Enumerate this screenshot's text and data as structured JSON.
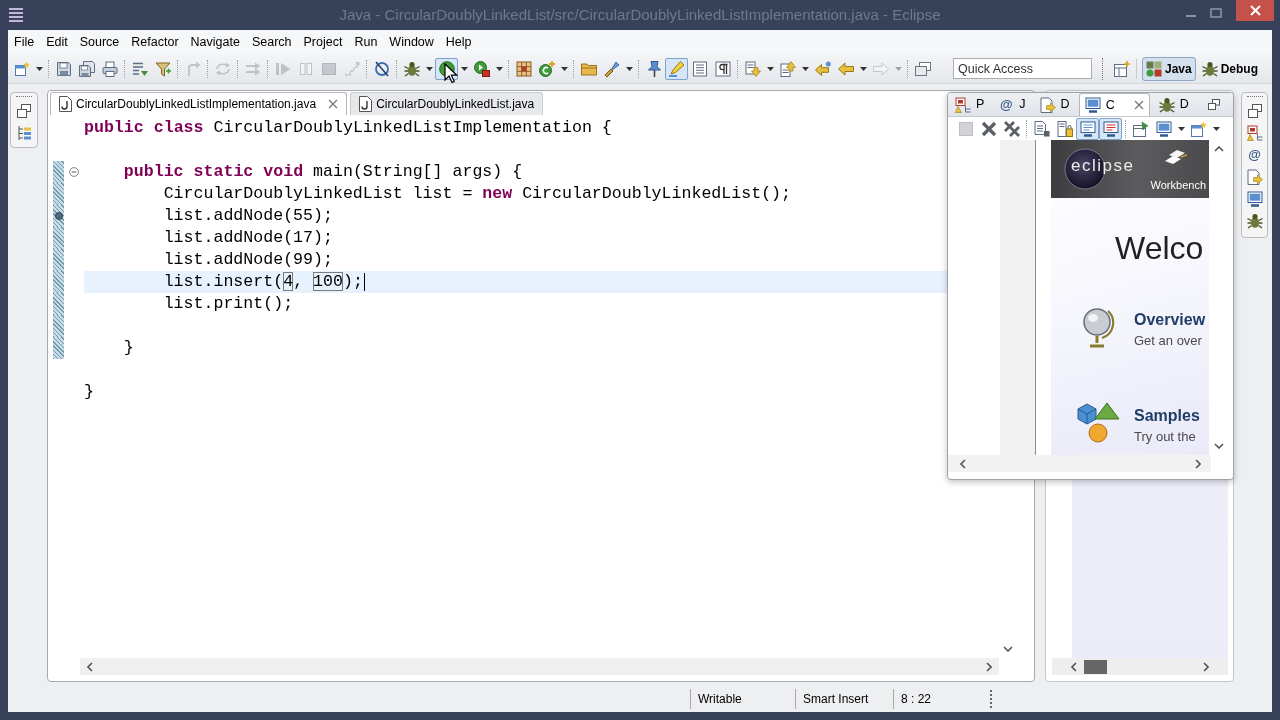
{
  "window": {
    "title": "Java - CircularDoublyLinkedList/src/CircularDoublyLinkedListImplementation.java - Eclipse"
  },
  "menu": [
    "File",
    "Edit",
    "Source",
    "Refactor",
    "Navigate",
    "Search",
    "Project",
    "Run",
    "Window",
    "Help"
  ],
  "toolbar": {
    "groups": [
      [
        {
          "kind": "new",
          "on": false,
          "disabled": false
        },
        {
          "kind": "dropdown",
          "on": false,
          "disabled": false
        }
      ],
      [
        {
          "kind": "save",
          "on": false,
          "disabled": false
        },
        {
          "kind": "save_all",
          "on": false,
          "disabled": false
        },
        {
          "kind": "print",
          "on": false,
          "disabled": false
        }
      ],
      [
        {
          "kind": "breadcrumb",
          "on": false,
          "disabled": false
        },
        {
          "kind": "filter",
          "on": false,
          "disabled": false
        }
      ],
      [
        {
          "kind": "curved_arrow",
          "on": false,
          "disabled": true
        }
      ],
      [
        {
          "kind": "cycle",
          "on": false,
          "disabled": true
        }
      ],
      [
        {
          "kind": "double_arrow",
          "on": false,
          "disabled": true
        }
      ],
      [
        {
          "kind": "resume",
          "on": false,
          "disabled": true
        },
        {
          "kind": "suspend",
          "on": false,
          "disabled": true
        },
        {
          "kind": "terminate",
          "on": false,
          "disabled": true
        },
        {
          "kind": "disconnect",
          "on": false,
          "disabled": true
        }
      ],
      [
        {
          "kind": "skip_breakpoints",
          "on": false,
          "disabled": false
        }
      ],
      [
        {
          "kind": "debug",
          "on": false,
          "disabled": false
        },
        {
          "kind": "dropdown",
          "on": false,
          "disabled": false
        },
        {
          "kind": "run",
          "on": true,
          "disabled": false
        },
        {
          "kind": "dropdown",
          "on": false,
          "disabled": false
        },
        {
          "kind": "external_tools",
          "on": false,
          "disabled": false
        },
        {
          "kind": "dropdown",
          "on": false,
          "disabled": false
        }
      ],
      [
        {
          "kind": "new_package",
          "on": false,
          "disabled": false
        },
        {
          "kind": "new_class",
          "on": false,
          "disabled": false
        },
        {
          "kind": "dropdown",
          "on": false,
          "disabled": false
        }
      ],
      [
        {
          "kind": "open_type",
          "on": false,
          "disabled": false
        },
        {
          "kind": "search",
          "on": false,
          "disabled": false
        },
        {
          "kind": "dropdown",
          "on": false,
          "disabled": false
        }
      ],
      [
        {
          "kind": "task",
          "on": false,
          "disabled": false
        },
        {
          "kind": "mark_occurrences",
          "on": true,
          "disabled": false
        },
        {
          "kind": "block_selection",
          "on": false,
          "disabled": false
        },
        {
          "kind": "show_whitespace",
          "on": false,
          "disabled": false
        }
      ],
      [
        {
          "kind": "next_annotation",
          "on": false,
          "disabled": false
        },
        {
          "kind": "dropdown",
          "on": false,
          "disabled": false
        },
        {
          "kind": "previous_annotation",
          "on": false,
          "disabled": false
        },
        {
          "kind": "dropdown",
          "on": false,
          "disabled": false
        },
        {
          "kind": "last_edit",
          "on": false,
          "disabled": false
        },
        {
          "kind": "back",
          "on": false,
          "disabled": false
        },
        {
          "kind": "dropdown",
          "on": false,
          "disabled": false
        },
        {
          "kind": "forward",
          "on": false,
          "disabled": true
        },
        {
          "kind": "dropdown",
          "on": false,
          "disabled": true
        }
      ],
      [
        {
          "kind": "pin_editor",
          "on": false,
          "disabled": false
        }
      ]
    ],
    "quick_access": {
      "placeholder": "Quick Access"
    },
    "perspectives": [
      {
        "kind": "java",
        "label": "Java",
        "selected": true
      },
      {
        "kind": "debug",
        "label": "Debug",
        "selected": false
      }
    ]
  },
  "left_trim": {
    "items": [
      {
        "kind": "restore"
      },
      {
        "kind": "outline"
      }
    ]
  },
  "editor": {
    "tabs": [
      {
        "label": "CircularDoublyLinkedListImplementation.java",
        "selected": true
      },
      {
        "label": "CircularDoublyLinkedList.java",
        "selected": false
      }
    ],
    "lines": [
      {
        "kind": "code",
        "current": false,
        "changed": false,
        "fold": false,
        "marker": false,
        "segments": [
          {
            "kind": "keyword",
            "text": "public "
          },
          {
            "kind": "keyword",
            "text": "class "
          },
          {
            "kind": "text",
            "text": "CircularDoublyLinkedListImplementation {"
          }
        ],
        "children": [
          {
            "kind": "blank",
            "current": false,
            "changed": false
          },
          {
            "kind": "code",
            "current": false,
            "changed": true,
            "fold": true,
            "marker": false,
            "segments": [
              {
                "kind": "keyword",
                "text": "public "
              },
              {
                "kind": "keyword",
                "text": "static "
              },
              {
                "kind": "keyword",
                "text": "void "
              },
              {
                "kind": "text",
                "text": "main(String[] args) {"
              }
            ],
            "children": [
              {
                "kind": "code",
                "current": false,
                "changed": true,
                "fold": false,
                "marker": false,
                "segments": [
                  {
                    "kind": "text",
                    "text": "CircularDoublyLinkedList list = "
                  },
                  {
                    "kind": "keyword",
                    "text": "new"
                  },
                  {
                    "kind": "text",
                    "text": " CircularDoublyLinkedList();"
                  }
                ]
              },
              {
                "kind": "code",
                "current": false,
                "changed": true,
                "fold": false,
                "marker": true,
                "segments": [
                  {
                    "kind": "text",
                    "text": "list.addNode(55);"
                  }
                ]
              },
              {
                "kind": "code",
                "current": false,
                "changed": true,
                "fold": false,
                "marker": false,
                "segments": [
                  {
                    "kind": "text",
                    "text": "list.addNode(17);"
                  }
                ]
              },
              {
                "kind": "code",
                "current": false,
                "changed": true,
                "fold": false,
                "marker": false,
                "segments": [
                  {
                    "kind": "text",
                    "text": "list.addNode(99);"
                  }
                ]
              },
              {
                "kind": "code",
                "current": true,
                "changed": true,
                "fold": false,
                "marker": false,
                "segments": [
                  {
                    "kind": "text",
                    "text": "list.insert("
                  },
                  {
                    "kind": "linked",
                    "text": "4"
                  },
                  {
                    "kind": "text",
                    "text": ", "
                  },
                  {
                    "kind": "linked",
                    "text": "100"
                  },
                  {
                    "kind": "text",
                    "text": ");"
                  }
                ]
              },
              {
                "kind": "code",
                "current": false,
                "changed": true,
                "fold": false,
                "marker": false,
                "segments": [
                  {
                    "kind": "text",
                    "text": "list.print();"
                  }
                ]
              },
              {
                "kind": "blank",
                "current": false,
                "changed": true
              }
            ]
          },
          {
            "kind": "code",
            "current": false,
            "changed": true,
            "fold": false,
            "marker": false,
            "segments": [
              {
                "kind": "text",
                "text": "}"
              }
            ]
          },
          {
            "kind": "blank",
            "current": false,
            "changed": false
          }
        ]
      },
      {
        "kind": "code",
        "current": false,
        "changed": false,
        "fold": false,
        "marker": false,
        "segments": [
          {
            "kind": "text",
            "text": "}"
          }
        ]
      }
    ]
  },
  "panel": {
    "tabs": [
      {
        "kind": "package",
        "label": "P",
        "selected": false
      },
      {
        "kind": "javadoc",
        "glyph": "@",
        "label": "J",
        "selected": false
      },
      {
        "kind": "declaration",
        "label": "D",
        "selected": false
      },
      {
        "kind": "console",
        "label": "C",
        "selected": true
      },
      {
        "kind": "debug",
        "label": "D",
        "selected": false
      }
    ],
    "toolbar": [
      [
        {
          "kind": "stop",
          "on": false,
          "disabled": true
        },
        {
          "kind": "remove",
          "on": false,
          "disabled": false
        },
        {
          "kind": "remove_all",
          "on": false,
          "disabled": false
        }
      ],
      [
        {
          "kind": "clear",
          "on": false,
          "disabled": false
        },
        {
          "kind": "scroll_lock",
          "on": false,
          "disabled": false
        },
        {
          "kind": "show_stdout",
          "on": true,
          "disabled": false
        },
        {
          "kind": "show_stderr",
          "on": true,
          "disabled": false
        }
      ],
      [
        {
          "kind": "pin_console",
          "on": false,
          "disabled": false
        },
        {
          "kind": "display_console",
          "on": false,
          "disabled": false
        },
        {
          "kind": "dropdown",
          "on": false,
          "disabled": false
        },
        {
          "kind": "open_console",
          "on": false,
          "disabled": false
        },
        {
          "kind": "dropdown",
          "on": false,
          "disabled": false
        }
      ]
    ],
    "welcome": {
      "logo": "eclipse",
      "subtitle": "Workbench",
      "heading": "Welco",
      "items": [
        {
          "kind": "globe",
          "title": "Overview",
          "description": "Get an over"
        },
        {
          "kind": "shapes",
          "title": "Samples",
          "description": "Try out the"
        }
      ]
    }
  },
  "right_trim": {
    "items": [
      {
        "kind": "restore"
      },
      {
        "kind": "package"
      },
      {
        "kind": "javadoc",
        "glyph": "@"
      },
      {
        "kind": "declaration"
      },
      {
        "kind": "console"
      },
      {
        "kind": "debug"
      }
    ]
  },
  "status_bar": {
    "fields": [
      "Writable",
      "Smart Insert",
      "8 : 22"
    ]
  }
}
